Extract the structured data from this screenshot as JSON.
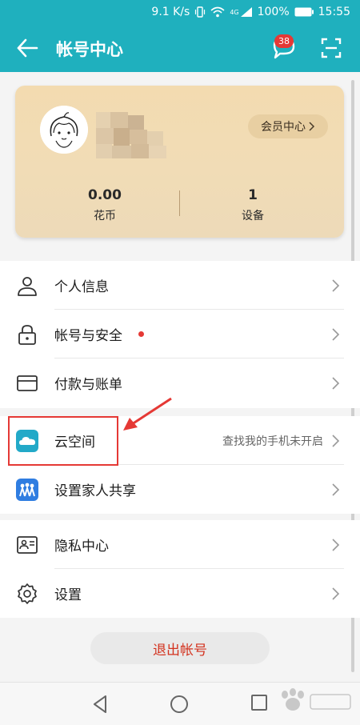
{
  "status_bar": {
    "network_speed": "9.1 K/s",
    "signal_label": "4G",
    "battery": "100%",
    "time": "15:55"
  },
  "app_bar": {
    "title": "帐号中心",
    "message_badge": "38",
    "back_icon": "arrow-left-icon",
    "message_icon": "chat-bubble-icon",
    "scan_icon": "scan-icon"
  },
  "member_card": {
    "vip_button_label": "会员中心",
    "stats": [
      {
        "value": "0.00",
        "label": "花币"
      },
      {
        "value": "1",
        "label": "设备"
      }
    ]
  },
  "menu": {
    "group1": [
      {
        "label": "个人信息",
        "icon": "person-icon"
      },
      {
        "label": "帐号与安全",
        "icon": "lock-icon",
        "red_dot": true
      },
      {
        "label": "付款与账单",
        "icon": "card-icon"
      }
    ],
    "group2": [
      {
        "label": "云空间",
        "icon": "cloud-icon",
        "hint": "查找我的手机未开启"
      },
      {
        "label": "设置家人共享",
        "icon": "family-share-icon"
      }
    ],
    "group3": [
      {
        "label": "隐私中心",
        "icon": "privacy-icon"
      },
      {
        "label": "设置",
        "icon": "gear-icon"
      }
    ]
  },
  "logout_label": "退出帐号",
  "colors": {
    "primary": "#1fb0be",
    "accent_red": "#e53935",
    "card_gold": "#f1dcb6"
  }
}
